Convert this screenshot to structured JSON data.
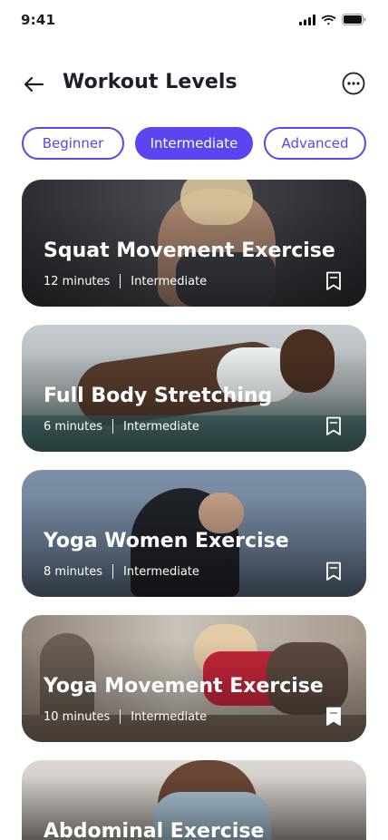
{
  "status": {
    "time": "9:41"
  },
  "header": {
    "title": "Workout Levels"
  },
  "tabs": [
    {
      "label": "Beginner",
      "active": false
    },
    {
      "label": "Intermediate",
      "active": true
    },
    {
      "label": "Advanced",
      "active": false
    }
  ],
  "workouts": [
    {
      "title": "Squat Movement Exercise",
      "duration": "12 minutes",
      "level": "Intermediate",
      "bookmarked": false
    },
    {
      "title": "Full Body Stretching",
      "duration": "6 minutes",
      "level": "Intermediate",
      "bookmarked": false
    },
    {
      "title": "Yoga Women Exercise",
      "duration": "8 minutes",
      "level": "Intermediate",
      "bookmarked": false
    },
    {
      "title": "Yoga Movement Exercise",
      "duration": "10 minutes",
      "level": "Intermediate",
      "bookmarked": true
    },
    {
      "title": "Abdominal Exercise",
      "duration": "",
      "level": "",
      "bookmarked": false
    }
  ],
  "colors": {
    "accent": "#5b45f0",
    "text": "#1e1e2a",
    "background": "#ffffff"
  },
  "icons": [
    "signal-icon",
    "wifi-icon",
    "battery-icon",
    "back-arrow-icon",
    "more-icon",
    "bookmark-icon"
  ]
}
